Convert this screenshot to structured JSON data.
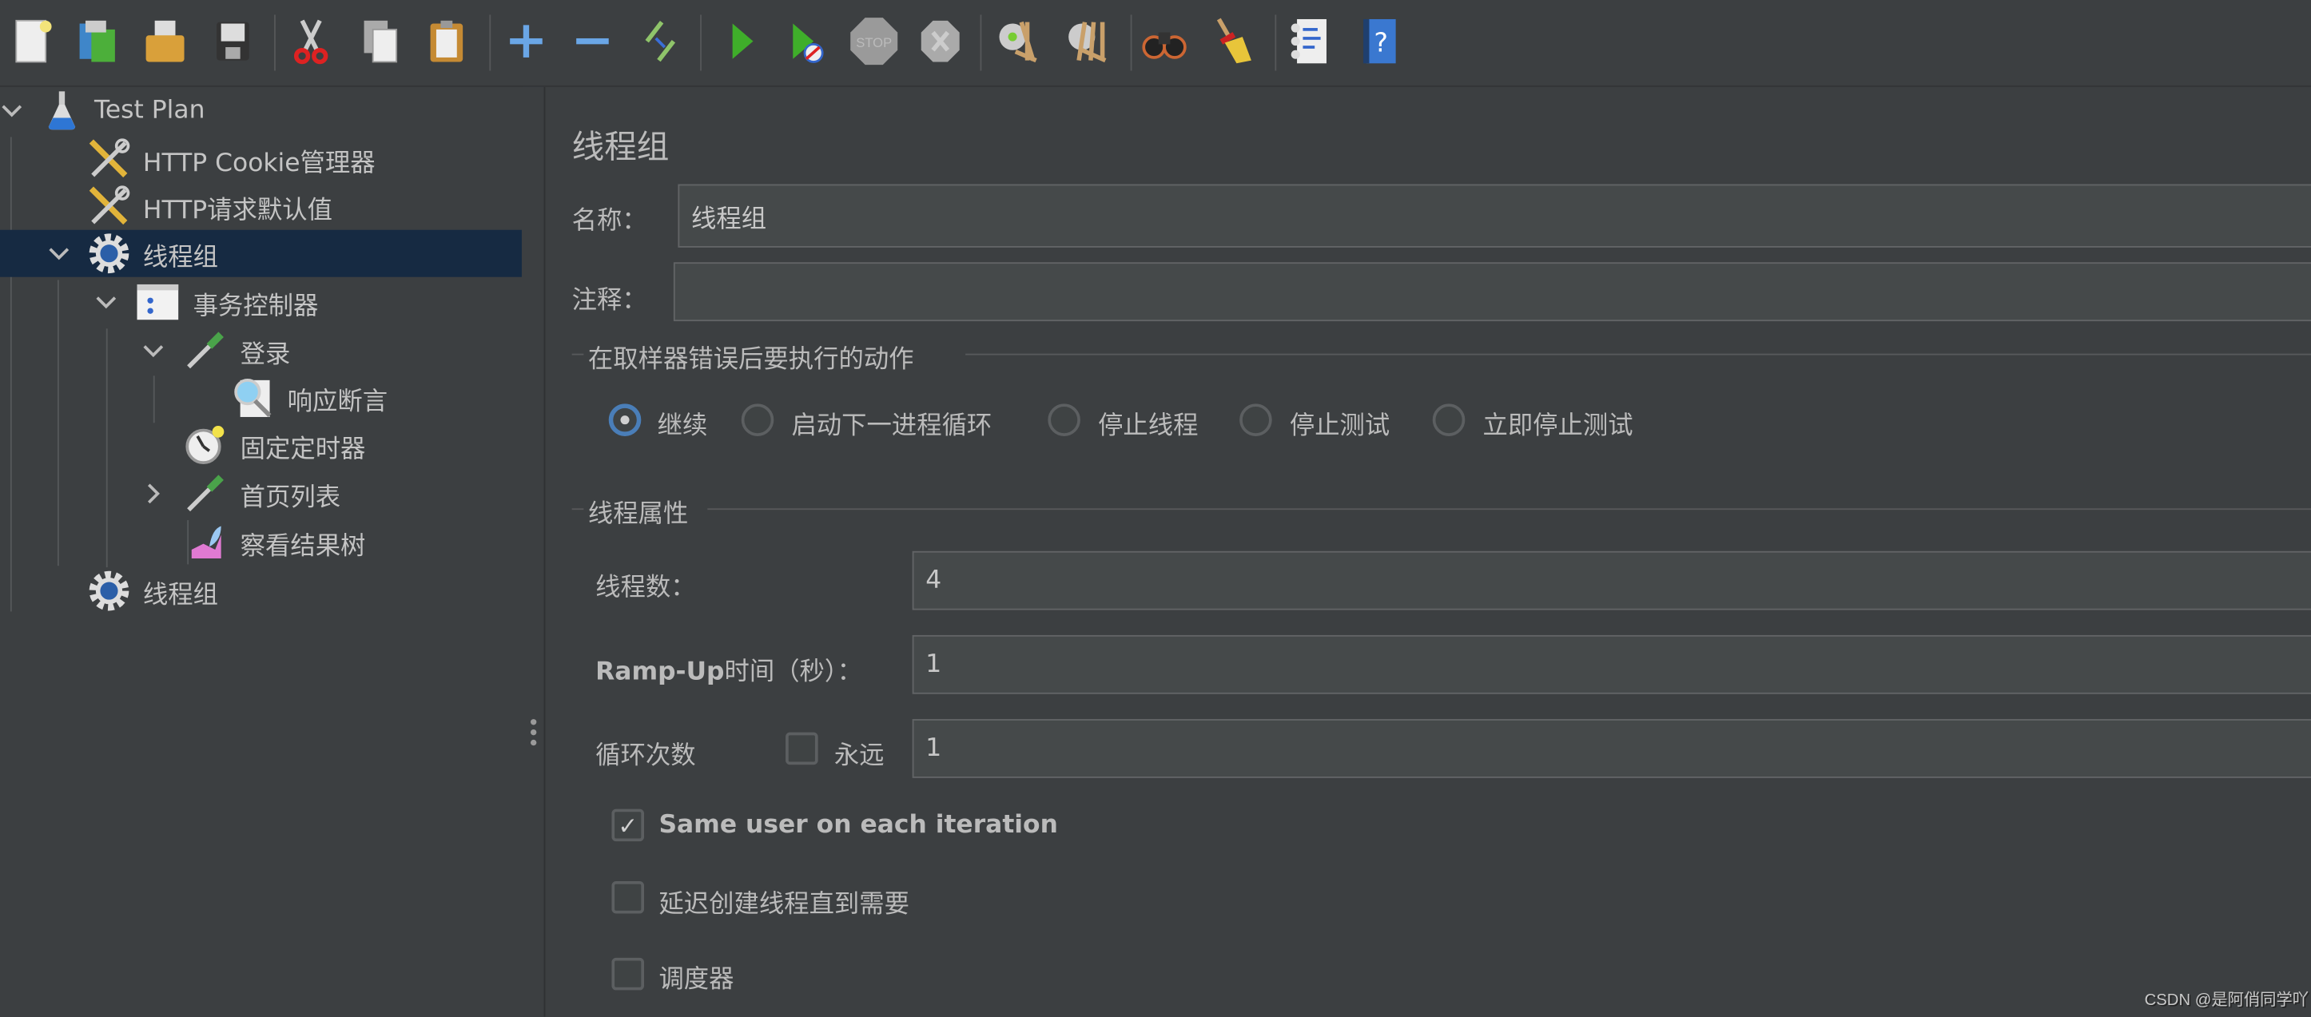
{
  "toolbar": {
    "icons": [
      "new-icon",
      "templates-icon",
      "open-icon",
      "save-icon",
      "cut-icon",
      "copy-icon",
      "paste-icon",
      "expand-icon",
      "collapse-icon",
      "toggle-icon",
      "start-icon",
      "start-no-pauses-icon",
      "stop-icon",
      "shutdown-icon",
      "clear-icon",
      "clear-all-icon",
      "search-icon",
      "reset-search-icon",
      "function-helper-icon",
      "help-icon"
    ],
    "stop_label": "STOP"
  },
  "tree": {
    "items": [
      {
        "label": "Test Plan",
        "icon": "flask-icon",
        "level": 0,
        "expanded": true
      },
      {
        "label": "HTTP Cookie管理器",
        "icon": "tools-icon",
        "level": 1
      },
      {
        "label": "HTTP请求默认值",
        "icon": "tools-icon",
        "level": 1
      },
      {
        "label": "线程组",
        "icon": "gear-icon",
        "level": 1,
        "expanded": true,
        "selected": true
      },
      {
        "label": "事务控制器",
        "icon": "controller-icon",
        "level": 2,
        "expanded": true
      },
      {
        "label": "登录",
        "icon": "pipette-icon",
        "level": 3,
        "expanded": true
      },
      {
        "label": "响应断言",
        "icon": "magnifier-icon",
        "level": 4
      },
      {
        "label": "固定定时器",
        "icon": "timer-icon",
        "level": 3
      },
      {
        "label": "首页列表",
        "icon": "pipette-icon",
        "level": 3,
        "expanded": false
      },
      {
        "label": "察看结果树",
        "icon": "chart-icon",
        "level": 3
      },
      {
        "label": "线程组",
        "icon": "gear-icon",
        "level": 1
      }
    ]
  },
  "panel": {
    "title": "线程组",
    "name_label": "名称：",
    "name_value": "线程组",
    "comment_label": "注释：",
    "comment_value": "",
    "error_action_legend": "在取样器错误后要执行的动作",
    "error_actions": [
      {
        "label": "继续",
        "selected": true
      },
      {
        "label": "启动下一进程循环",
        "selected": false
      },
      {
        "label": "停止线程",
        "selected": false
      },
      {
        "label": "停止测试",
        "selected": false
      },
      {
        "label": "立即停止测试",
        "selected": false
      }
    ],
    "thread_props_legend": "线程属性",
    "threads_label": "线程数：",
    "threads_value": "4",
    "rampup_label_bold": "Ramp-Up",
    "rampup_label_rest": "时间（秒）：",
    "rampup_value": "1",
    "loop_label": "循环次数",
    "forever_label": "永远",
    "forever_checked": false,
    "loop_value": "1",
    "same_user_label": "Same user on each iteration",
    "same_user_checked": true,
    "delay_label": "延迟创建线程直到需要",
    "delay_checked": false,
    "scheduler_label": "调度器",
    "scheduler_checked": false
  },
  "watermark": "CSDN @是阿俏同学吖",
  "colors": {
    "background": "#3c3f41",
    "selection": "#162a42",
    "input": "#45494a",
    "radio_accent": "#4a7eb8"
  }
}
